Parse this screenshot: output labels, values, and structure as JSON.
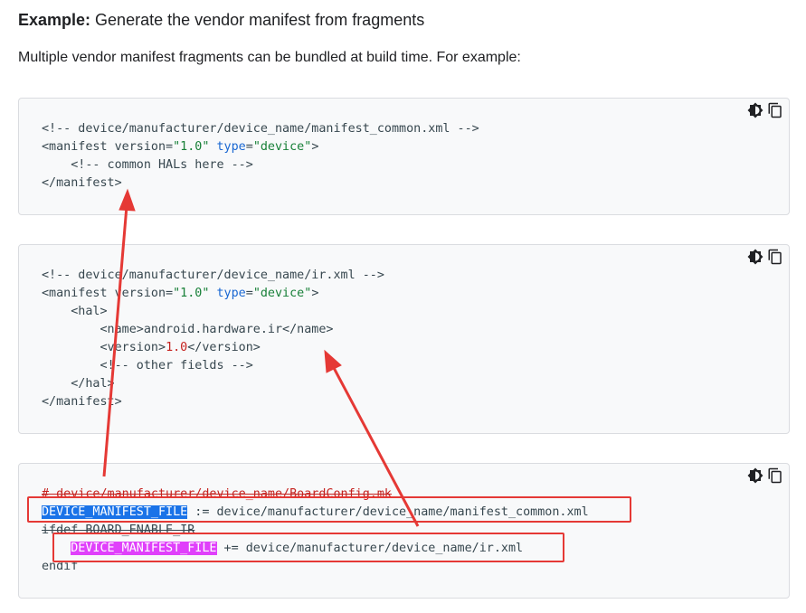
{
  "heading": {
    "bold": "Example:",
    "rest": " Generate the vendor manifest from fragments"
  },
  "intro": "Multiple vendor manifest fragments can be bundled at build time. For example:",
  "blocks": [
    {
      "lines": [
        "<!-- device/manufacturer/device_name/manifest_common.xml -->",
        "<manifest version=\"1.0\" type=\"device\">",
        "    <!-- common HALs here -->",
        "</manifest>"
      ]
    },
    {
      "lines": [
        "<!-- device/manufacturer/device_name/ir.xml -->",
        "<manifest version=\"1.0\" type=\"device\">",
        "    <hal>",
        "        <name>android.hardware.ir</name>",
        "        <version>1.0</version>",
        "        <!-- other fields -->",
        "    </hal>",
        "</manifest>"
      ]
    },
    {
      "comment": "# device/manufacturer/device_name/BoardConfig.mk",
      "var1": "DEVICE_MANIFEST_FILE",
      "rest1": " := device/manufacturer/device_name/manifest_common.xml",
      "ifdef": "ifdef BOARD_ENABLE_IR",
      "indent": "    ",
      "var2": "DEVICE_MANIFEST_FILE",
      "rest2": " += device/manufacturer/device_name/ir.xml",
      "endif": "endif"
    }
  ],
  "toolbar": {
    "theme_icon": "theme-toggle-icon",
    "copy_icon": "copy-icon"
  },
  "colors": {
    "annotation_red": "#e53935",
    "highlight_blue": "#1a73e8",
    "highlight_magenta": "#e040fb"
  }
}
